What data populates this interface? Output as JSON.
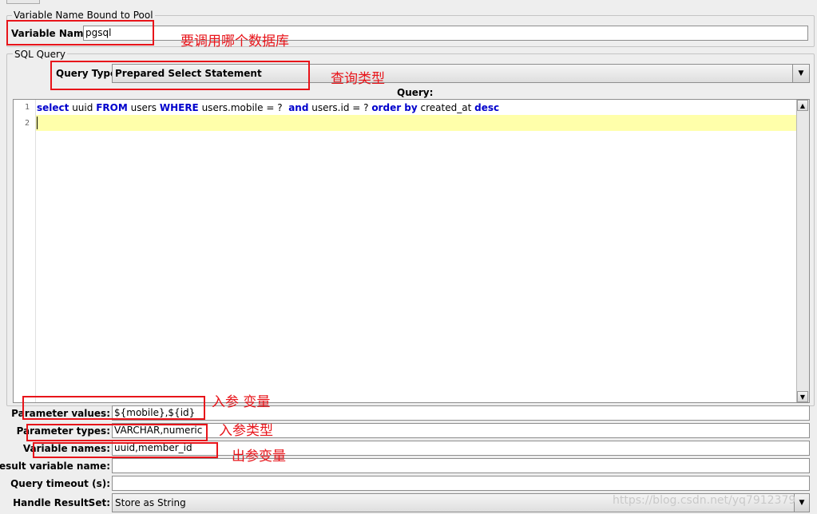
{
  "pool_group": {
    "legend": "Variable Name Bound to Pool",
    "variable_name_label": "Variable Name:",
    "variable_name_value": "pgsql"
  },
  "sql_group": {
    "legend": "SQL Query",
    "query_type_label": "Query Type:",
    "query_type_value": "Prepared Select Statement",
    "query_label": "Query:",
    "line_numbers": [
      "1",
      "2"
    ],
    "code_line1": [
      {
        "t": "select",
        "kw": true
      },
      {
        "t": " uuid ",
        "kw": false
      },
      {
        "t": "FROM",
        "kw": true
      },
      {
        "t": " users ",
        "kw": false
      },
      {
        "t": "WHERE",
        "kw": true
      },
      {
        "t": " users.mobile = ?  ",
        "kw": false
      },
      {
        "t": "and",
        "kw": true
      },
      {
        "t": " users.id = ? ",
        "kw": false
      },
      {
        "t": "order by",
        "kw": true
      },
      {
        "t": " created_at ",
        "kw": false
      },
      {
        "t": "desc",
        "kw": true
      }
    ]
  },
  "params": {
    "parameter_values_label": "Parameter values:",
    "parameter_values_value": "${mobile},${id}",
    "parameter_types_label": "Parameter types:",
    "parameter_types_value": "VARCHAR,numeric",
    "variable_names_label": "Variable names:",
    "variable_names_value": "uuid,member_id",
    "result_variable_label": "Result variable name:",
    "result_variable_value": "",
    "query_timeout_label": "Query timeout (s):",
    "query_timeout_value": "",
    "handle_resultset_label": "Handle ResultSet:",
    "handle_resultset_value": "Store as String"
  },
  "annotations": {
    "which_database": "要调用哪个数据库",
    "query_type": "查询类型",
    "input_variables": "入参 变量",
    "input_types": "入参类型",
    "output_variables": "出参变量"
  },
  "watermark": "https://blog.csdn.net/yq7912379",
  "colors": {
    "keyword": "#0000cc",
    "annotation_red": "#e8141a",
    "current_line": "#ffffaa"
  }
}
